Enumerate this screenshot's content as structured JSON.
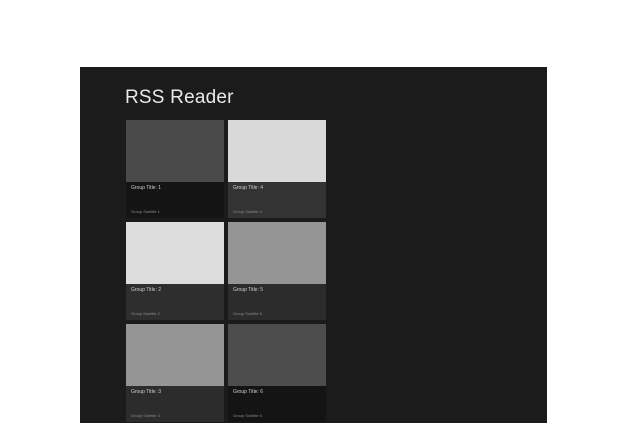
{
  "app": {
    "title": "RSS Reader"
  },
  "groups": [
    {
      "title": "Group Title: 1",
      "subtitle": "Group Subtitle 1",
      "image_color": "#4a4a4a",
      "caption_color": "#141414"
    },
    {
      "title": "Group Title: 4",
      "subtitle": "Group Subtitle 4",
      "image_color": "#d9d9d9",
      "caption_color": "#333333"
    },
    {
      "title": "Group Title: 2",
      "subtitle": "Group Subtitle 2",
      "image_color": "#dddddd",
      "caption_color": "#2e2e2e"
    },
    {
      "title": "Group Title: 5",
      "subtitle": "Group Subtitle 5",
      "image_color": "#959595",
      "caption_color": "#2c2c2c"
    },
    {
      "title": "Group Title: 3",
      "subtitle": "Group Subtitle 3",
      "image_color": "#959595",
      "caption_color": "#2c2c2c"
    },
    {
      "title": "Group Title: 6",
      "subtitle": "Group Subtitle 6",
      "image_color": "#4d4d4d",
      "caption_color": "#141414"
    }
  ]
}
